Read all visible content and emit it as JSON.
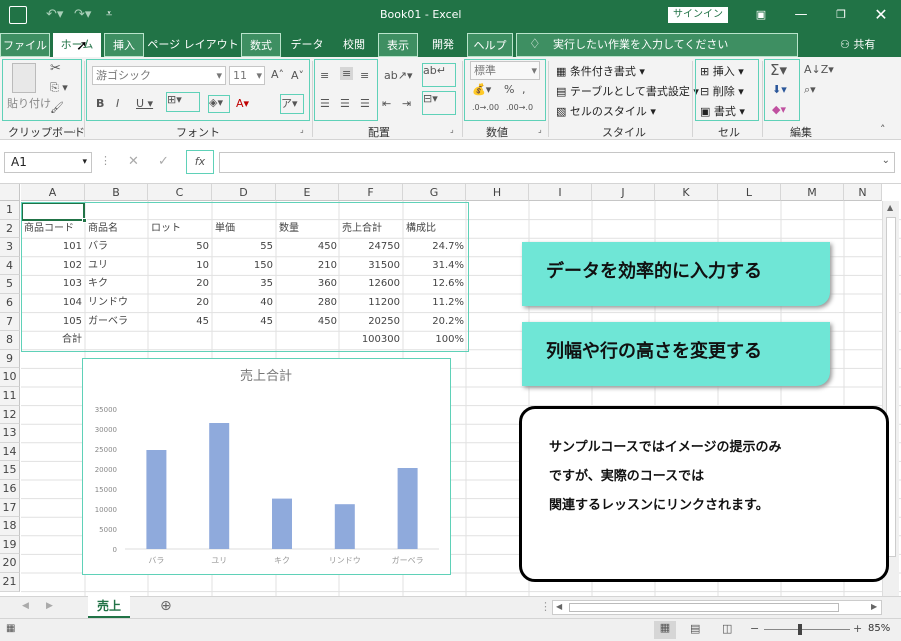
{
  "window": {
    "title": "Book01  -  Excel",
    "signin": "サインイン",
    "share": "共有"
  },
  "tabs": [
    "ファイル",
    "ホーム",
    "挿入",
    "ページ レイアウト",
    "数式",
    "データ",
    "校閲",
    "表示",
    "開発",
    "ヘルプ"
  ],
  "tellme": "実行したい作業を入力してください",
  "ribbon": {
    "clipboard": {
      "paste": "貼り付け",
      "label": "クリップボード"
    },
    "font": {
      "name": "游ゴシック",
      "size": "11",
      "label": "フォント"
    },
    "alignment": {
      "label": "配置"
    },
    "number": {
      "format": "標準",
      "label": "数値"
    },
    "styles": {
      "conditional": "条件付き書式",
      "table": "テーブルとして書式設定",
      "cell": "セルのスタイル",
      "label": "スタイル"
    },
    "cells": {
      "insert": "挿入",
      "delete": "削除",
      "format": "書式",
      "label": "セル"
    },
    "editing": {
      "label": "編集"
    }
  },
  "formula_bar": {
    "name_box": "A1",
    "fx": "fx",
    "content": ""
  },
  "columns": [
    "A",
    "B",
    "C",
    "D",
    "E",
    "F",
    "G",
    "H",
    "I",
    "J",
    "K",
    "L",
    "M",
    "N"
  ],
  "rows": [
    "1",
    "2",
    "3",
    "4",
    "5",
    "6",
    "7",
    "8",
    "9",
    "10",
    "11",
    "12",
    "13",
    "14",
    "15",
    "16",
    "17",
    "18",
    "19",
    "20",
    "21"
  ],
  "table": {
    "headers": [
      "商品コード",
      "商品名",
      "ロット",
      "単価",
      "数量",
      "売上合計",
      "構成比"
    ],
    "rows": [
      [
        "101",
        "バラ",
        "50",
        "55",
        "450",
        "24750",
        "24.7%"
      ],
      [
        "102",
        "ユリ",
        "10",
        "150",
        "210",
        "31500",
        "31.4%"
      ],
      [
        "103",
        "キク",
        "20",
        "35",
        "360",
        "12600",
        "12.6%"
      ],
      [
        "104",
        "リンドウ",
        "20",
        "40",
        "280",
        "11200",
        "11.2%"
      ],
      [
        "105",
        "ガーベラ",
        "45",
        "45",
        "450",
        "20250",
        "20.2%"
      ]
    ],
    "total_label": "合計",
    "total_sales": "100300",
    "total_ratio": "100%"
  },
  "chart_data": {
    "type": "bar",
    "title": "売上合計",
    "categories": [
      "バラ",
      "ユリ",
      "キク",
      "リンドウ",
      "ガーベラ"
    ],
    "values": [
      24750,
      31500,
      12600,
      11200,
      20250
    ],
    "ylim": [
      0,
      35000
    ],
    "yticks": [
      "35000",
      "30000",
      "25000",
      "20000",
      "15000",
      "10000",
      "5000",
      "0"
    ],
    "grid": false,
    "color": "#8faadc"
  },
  "callouts": [
    "データを効率的に入力する",
    "列幅や行の高さを変更する"
  ],
  "info": [
    "サンプルコースではイメージの提示のみ",
    "ですが、実際のコースでは",
    "関連するレッスンにリンクされます。"
  ],
  "sheet_tab": "売上",
  "zoom": "85%",
  "colors": {
    "excel_green": "#217346",
    "accent": "#5fd1b8",
    "callout": "#6fe6d6"
  }
}
